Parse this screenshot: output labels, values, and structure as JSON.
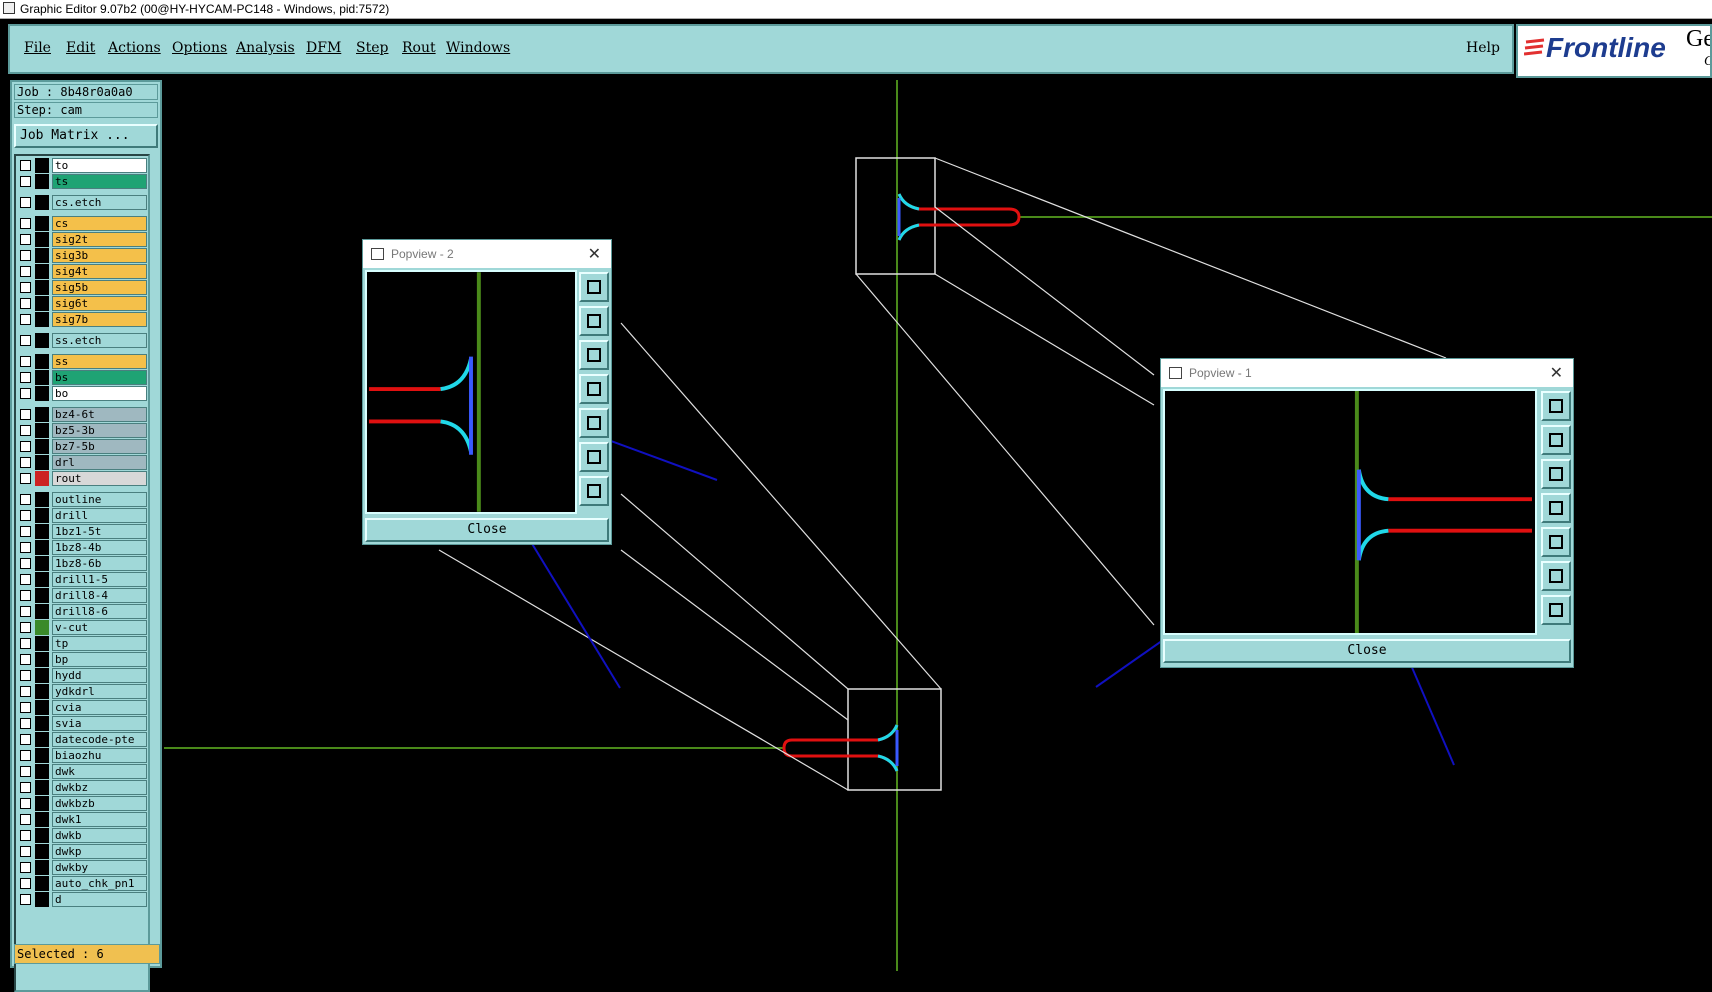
{
  "window": {
    "title": "Graphic Editor 9.07b2 (00@HY-HYCAM-PC148 - Windows, pid:7572)"
  },
  "menu": {
    "items": [
      "File",
      "Edit",
      "Actions",
      "Options",
      "Analysis",
      "DFM",
      "Step",
      "Rout",
      "Windows"
    ],
    "help": "Help"
  },
  "logo": {
    "brand": "Frontline",
    "side_top": "Ge",
    "side_bottom": "C"
  },
  "left": {
    "job": "Job : 8b48r0a0a0",
    "step": "Step: cam",
    "job_matrix": "Job Matrix ...",
    "selected": "Selected : 6"
  },
  "layers": [
    {
      "name": "to",
      "color": "#ffffff",
      "mid": "#000000"
    },
    {
      "name": "ts",
      "color": "#1fa374",
      "mid": "#000000"
    },
    {
      "name": "cs.etch",
      "color": "#a0d8d8",
      "mid": "#000000"
    },
    {
      "name": "cs",
      "color": "#f4c04a",
      "mid": "#000000"
    },
    {
      "name": "sig2t",
      "color": "#f4c04a",
      "mid": "#000000"
    },
    {
      "name": "sig3b",
      "color": "#f4c04a",
      "mid": "#000000"
    },
    {
      "name": "sig4t",
      "color": "#f4c04a",
      "mid": "#000000"
    },
    {
      "name": "sig5b",
      "color": "#f4c04a",
      "mid": "#000000"
    },
    {
      "name": "sig6t",
      "color": "#f4c04a",
      "mid": "#000000"
    },
    {
      "name": "sig7b",
      "color": "#f4c04a",
      "mid": "#000000"
    },
    {
      "name": "ss.etch",
      "color": "#a0d8d8",
      "mid": "#000000"
    },
    {
      "name": "ss",
      "color": "#f4c04a",
      "mid": "#000000"
    },
    {
      "name": "bs",
      "color": "#1fa374",
      "mid": "#000000"
    },
    {
      "name": "bo",
      "color": "#ffffff",
      "mid": "#000000"
    },
    {
      "name": "bz4-6t",
      "color": "#9fb8c0",
      "mid": "#000000"
    },
    {
      "name": "bz5-3b",
      "color": "#9fb8c0",
      "mid": "#000000"
    },
    {
      "name": "bz7-5b",
      "color": "#9fb8c0",
      "mid": "#000000"
    },
    {
      "name": "drl",
      "color": "#9fb8c0",
      "mid": "#000000"
    },
    {
      "name": "rout",
      "color": "#d8d8d8",
      "mid": "#cc2222"
    },
    {
      "name": "outline",
      "color": "#a0d8d8",
      "mid": "#000000"
    },
    {
      "name": "drill",
      "color": "#a0d8d8",
      "mid": "#000000"
    },
    {
      "name": "1bz1-5t",
      "color": "#a0d8d8",
      "mid": "#000000"
    },
    {
      "name": "1bz8-4b",
      "color": "#a0d8d8",
      "mid": "#000000"
    },
    {
      "name": "1bz8-6b",
      "color": "#a0d8d8",
      "mid": "#000000"
    },
    {
      "name": "drill1-5",
      "color": "#a0d8d8",
      "mid": "#000000"
    },
    {
      "name": "drill8-4",
      "color": "#a0d8d8",
      "mid": "#000000"
    },
    {
      "name": "drill8-6",
      "color": "#a0d8d8",
      "mid": "#000000"
    },
    {
      "name": "v-cut",
      "color": "#a0d8d8",
      "mid": "#3a8a2a"
    },
    {
      "name": "tp",
      "color": "#a0d8d8",
      "mid": "#000000"
    },
    {
      "name": "bp",
      "color": "#a0d8d8",
      "mid": "#000000"
    },
    {
      "name": "hydd",
      "color": "#a0d8d8",
      "mid": "#000000"
    },
    {
      "name": "ydkdrl",
      "color": "#a0d8d8",
      "mid": "#000000"
    },
    {
      "name": "cvia",
      "color": "#a0d8d8",
      "mid": "#000000"
    },
    {
      "name": "svia",
      "color": "#a0d8d8",
      "mid": "#000000"
    },
    {
      "name": "datecode-pte",
      "color": "#a0d8d8",
      "mid": "#000000"
    },
    {
      "name": "biaozhu",
      "color": "#a0d8d8",
      "mid": "#000000"
    },
    {
      "name": "dwk",
      "color": "#a0d8d8",
      "mid": "#000000"
    },
    {
      "name": "dwkbz",
      "color": "#a0d8d8",
      "mid": "#000000"
    },
    {
      "name": "dwkbzb",
      "color": "#a0d8d8",
      "mid": "#000000"
    },
    {
      "name": "dwk1",
      "color": "#a0d8d8",
      "mid": "#000000"
    },
    {
      "name": "dwkb",
      "color": "#a0d8d8",
      "mid": "#000000"
    },
    {
      "name": "dwkp",
      "color": "#a0d8d8",
      "mid": "#000000"
    },
    {
      "name": "dwkby",
      "color": "#a0d8d8",
      "mid": "#000000"
    },
    {
      "name": "auto_chk_pn1",
      "color": "#a0d8d8",
      "mid": "#000000"
    },
    {
      "name": "d",
      "color": "#a0d8d8",
      "mid": "#000000"
    }
  ],
  "popview2": {
    "title": "Popview - 2",
    "close_label": "Close"
  },
  "popview1": {
    "title": "Popview - 1",
    "close_label": "Close"
  },
  "colors": {
    "panel": "#a0d8d8",
    "canvas_bg": "#000000",
    "axis_green": "#4a8a1a",
    "trace_red": "#e01010",
    "trace_cyan": "#20d8e8",
    "annotation_blue": "#1010c0"
  }
}
